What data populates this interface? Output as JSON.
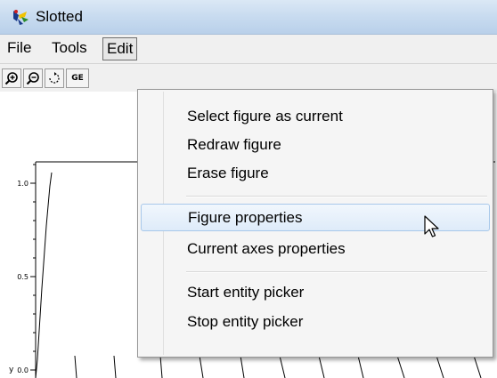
{
  "window": {
    "title": "Slotted"
  },
  "menubar": {
    "items": [
      "File",
      "Tools",
      "Edit"
    ],
    "active": "Edit"
  },
  "toolbar": {
    "buttons": [
      {
        "icon": "zoom-in-icon"
      },
      {
        "icon": "zoom-out-icon"
      },
      {
        "icon": "rotate-icon"
      },
      {
        "label": "GE"
      }
    ]
  },
  "plot": {
    "y_ticks": [
      "1.0",
      "0.5",
      "0.0"
    ],
    "y_axis_label": "y"
  },
  "edit_menu": {
    "groups": [
      [
        "Select figure as current",
        "Redraw figure",
        "Erase figure"
      ],
      [
        "Figure properties",
        "Current axes properties"
      ],
      [
        "Start entity picker",
        "Stop entity picker"
      ]
    ],
    "highlighted": "Figure properties"
  }
}
